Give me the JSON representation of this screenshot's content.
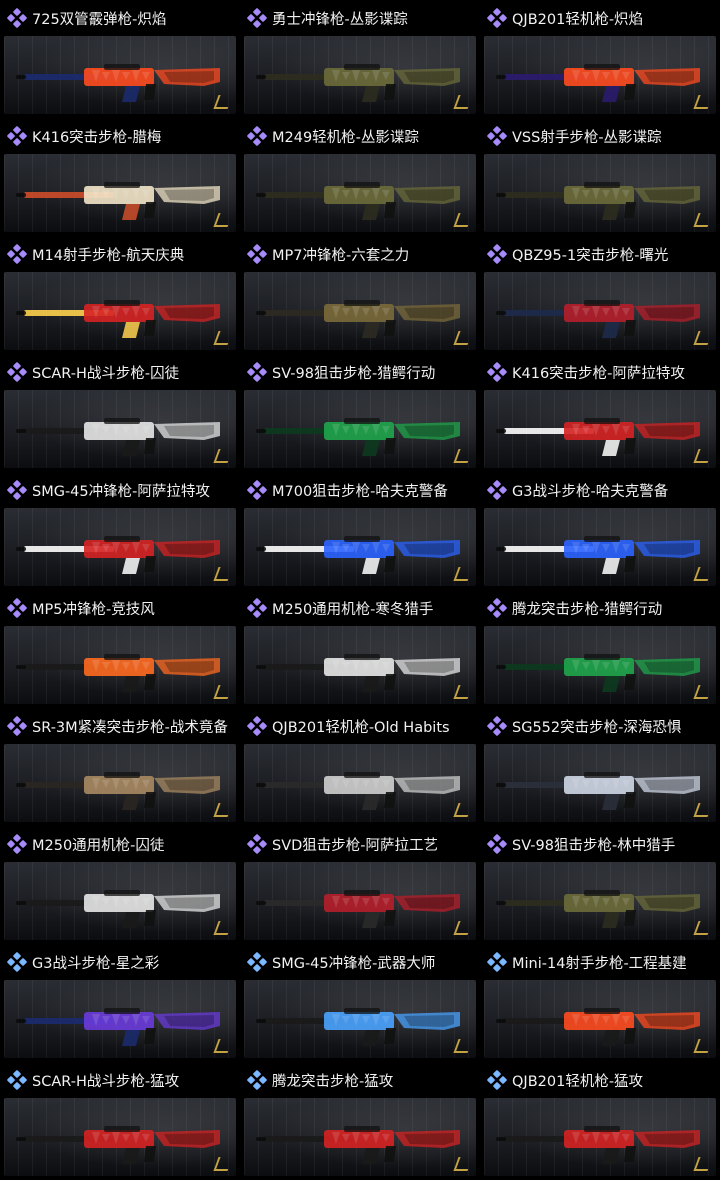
{
  "colors": {
    "purple": "#a78bfa",
    "blue": "#7bb8ff"
  },
  "items": [
    {
      "title": "725双管霰弹枪-炽焰",
      "rarity": "purple",
      "accent": "#ff4b1f",
      "accent2": "#1b2a6b"
    },
    {
      "title": "勇士冲锋枪-丛影谍踪",
      "rarity": "purple",
      "accent": "#6b6b3a",
      "accent2": "#2c2c1f"
    },
    {
      "title": "QJB201轻机枪-炽焰",
      "rarity": "purple",
      "accent": "#ff4b1f",
      "accent2": "#2a1b6b"
    },
    {
      "title": "K416突击步枪-腊梅",
      "rarity": "purple",
      "accent": "#f2e6c8",
      "accent2": "#c54b2a"
    },
    {
      "title": "M249轻机枪-丛影谍踪",
      "rarity": "purple",
      "accent": "#6b6b3a",
      "accent2": "#2c2c1f"
    },
    {
      "title": "VSS射手步枪-丛影谍踪",
      "rarity": "purple",
      "accent": "#6b6b3a",
      "accent2": "#2c2c1f"
    },
    {
      "title": "M14射手步枪-航天庆典",
      "rarity": "purple",
      "accent": "#d62222",
      "accent2": "#f2c84b"
    },
    {
      "title": "MP7冲锋枪-六套之力",
      "rarity": "purple",
      "accent": "#7a6a3a",
      "accent2": "#2c2a22"
    },
    {
      "title": "QBZ95-1突击步枪-曙光",
      "rarity": "purple",
      "accent": "#b51e2a",
      "accent2": "#1e2a4a"
    },
    {
      "title": "SCAR-H战斗步枪-囚徒",
      "rarity": "purple",
      "accent": "#e7e7e7",
      "accent2": "#1a1a1a"
    },
    {
      "title": "SV-98狙击步枪-猎鳄行动",
      "rarity": "purple",
      "accent": "#1fa54b",
      "accent2": "#0d3a1f"
    },
    {
      "title": "K416突击步枪-阿萨拉特攻",
      "rarity": "purple",
      "accent": "#d62222",
      "accent2": "#f2f2f2"
    },
    {
      "title": "SMG-45冲锋枪-阿萨拉特攻",
      "rarity": "purple",
      "accent": "#d62222",
      "accent2": "#f2f2f2"
    },
    {
      "title": "M700狙击步枪-哈夫克警备",
      "rarity": "purple",
      "accent": "#2a63ff",
      "accent2": "#f2f2f2"
    },
    {
      "title": "G3战斗步枪-哈夫克警备",
      "rarity": "purple",
      "accent": "#2a63ff",
      "accent2": "#f2f2f2"
    },
    {
      "title": "MP5冲锋枪-竞技风",
      "rarity": "purple",
      "accent": "#ff6a1f",
      "accent2": "#1a1a1a"
    },
    {
      "title": "M250通用机枪-寒冬猎手",
      "rarity": "purple",
      "accent": "#e7e7e7",
      "accent2": "#1a1a1a"
    },
    {
      "title": "腾龙突击步枪-猎鳄行动",
      "rarity": "purple",
      "accent": "#1fa54b",
      "accent2": "#0d3a1f"
    },
    {
      "title": "SR-3M紧凑突击步枪-战术竟备",
      "rarity": "purple",
      "accent": "#a88a62",
      "accent2": "#2a2622"
    },
    {
      "title": "QJB201轻机枪-Old Habits",
      "rarity": "purple",
      "accent": "#cfcfcf",
      "accent2": "#2a2a2a"
    },
    {
      "title": "SG552突击步枪-深海恐惧",
      "rarity": "purple",
      "accent": "#cfd7e6",
      "accent2": "#2a2f3a"
    },
    {
      "title": "M250通用机枪-囚徒",
      "rarity": "purple",
      "accent": "#e7e7e7",
      "accent2": "#1a1a1a"
    },
    {
      "title": "SVD狙击步枪-阿萨拉工艺",
      "rarity": "purple",
      "accent": "#b51e2a",
      "accent2": "#2a2a2a"
    },
    {
      "title": "SV-98狙击步枪-林中猎手",
      "rarity": "purple",
      "accent": "#6b6b3a",
      "accent2": "#2c2c1f"
    },
    {
      "title": "G3战斗步枪-星之彩",
      "rarity": "blue",
      "accent": "#6a3bdc",
      "accent2": "#1b2a6b"
    },
    {
      "title": "SMG-45冲锋枪-武器大师",
      "rarity": "blue",
      "accent": "#4aa3ff",
      "accent2": "#1a1a1a"
    },
    {
      "title": "Mini-14射手步枪-工程基建",
      "rarity": "blue",
      "accent": "#ff4b1f",
      "accent2": "#1a1a1a"
    },
    {
      "title": "SCAR-H战斗步枪-猛攻",
      "rarity": "blue",
      "accent": "#d62222",
      "accent2": "#1a1a1a"
    },
    {
      "title": "腾龙突击步枪-猛攻",
      "rarity": "blue",
      "accent": "#d62222",
      "accent2": "#1a1a1a"
    },
    {
      "title": "QJB201轻机枪-猛攻",
      "rarity": "blue",
      "accent": "#d62222",
      "accent2": "#1a1a1a"
    }
  ]
}
